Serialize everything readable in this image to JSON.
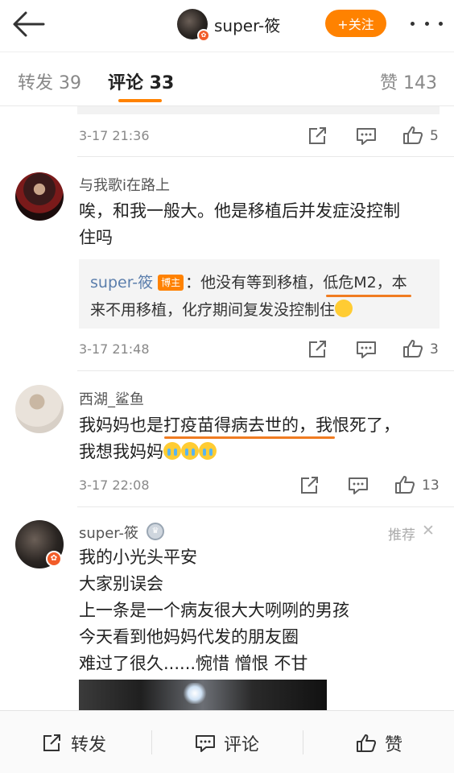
{
  "header": {
    "username": "super-筱",
    "follow_label": "+关注"
  },
  "tabs": [
    {
      "label": "转发 39"
    },
    {
      "label": "评论 33"
    },
    {
      "label": "赞 143"
    }
  ],
  "comments": [
    {
      "time": "3-17 21:36",
      "like_count": "5"
    },
    {
      "user": "与我歌i在路上",
      "text_line1": "唉，和我一般大。他是移植后并发症没控制",
      "text_line2": "住吗",
      "reply": {
        "name": "super-筱",
        "tag": "博主",
        "line1_prefix": "：他没有等到移植，",
        "line1_highlight": "低危M2",
        "line1_suffix": "，本",
        "line2": "来不用移植，化疗期间复发没控制住"
      },
      "time": "3-17 21:48",
      "like_count": "3"
    },
    {
      "user": "西湖_鲨鱼",
      "text_line1_a": "我妈妈也是",
      "text_line1_b": "打疫苗得病去世的",
      "text_line1_c": "，我恨死了，",
      "text_line2": "我想我妈妈",
      "time": "3-17 22:08",
      "like_count": "13"
    }
  ],
  "post": {
    "user": "super-筱",
    "recommend_label": "推荐",
    "lines": [
      "我的小光头平安",
      "大家别误会",
      "上一条是一个病友很大大咧咧的男孩",
      "今天看到他妈妈代发的朋友圈",
      "难过了很久......惋惜 憎恨 不甘"
    ]
  },
  "bottom_bar": {
    "repost": "转发",
    "comment": "评论",
    "like": "赞"
  }
}
